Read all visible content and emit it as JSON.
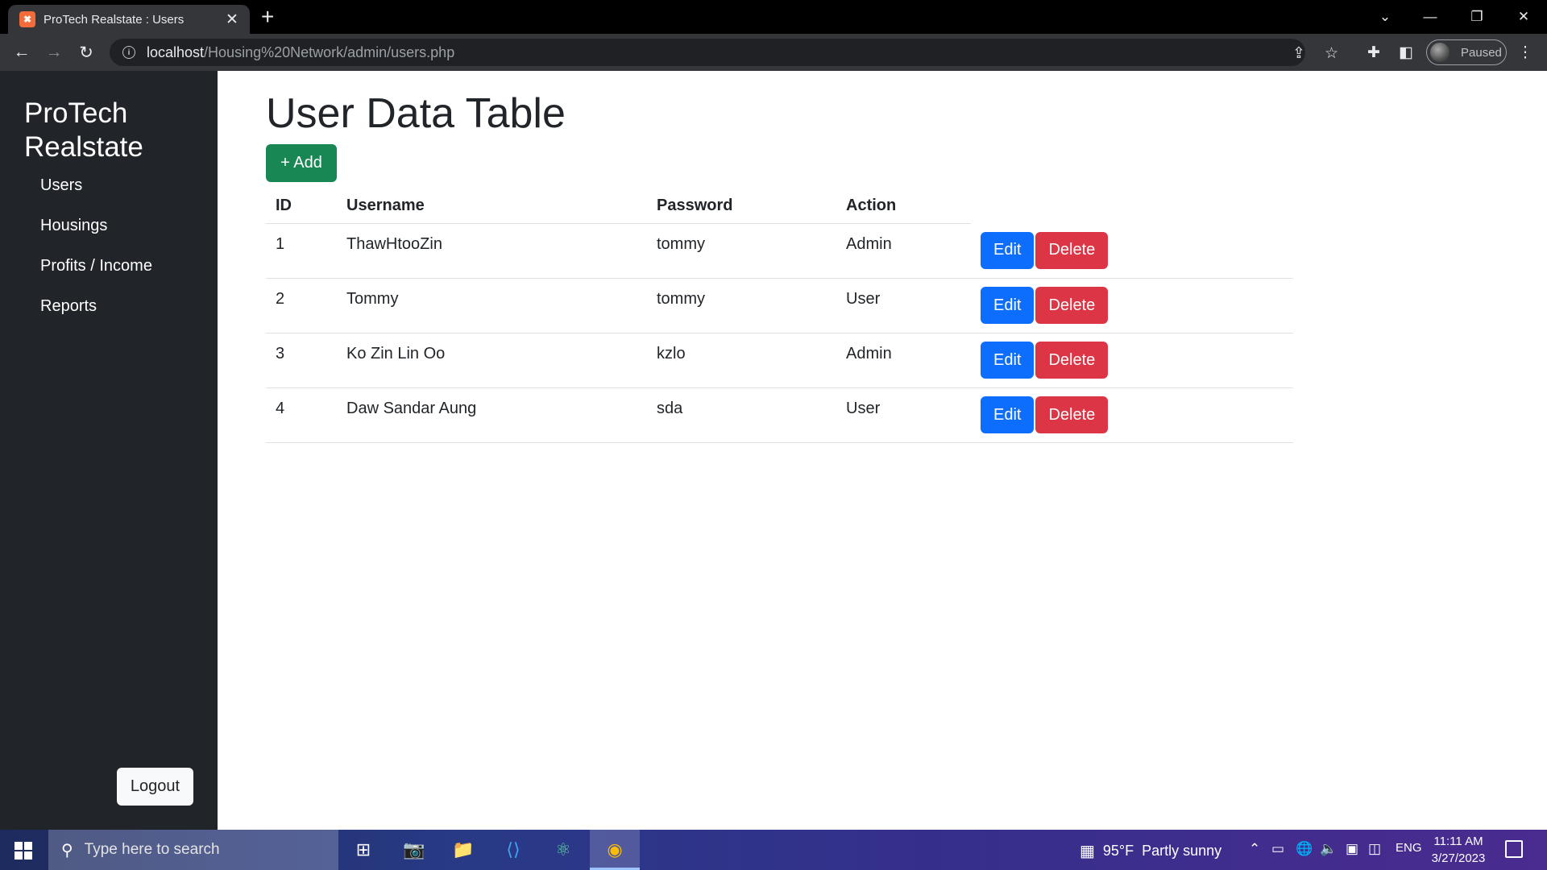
{
  "browser": {
    "tab_title": "ProTech Realstate : Users",
    "tab_favicon": "xampp-icon",
    "url_host": "localhost",
    "url_path": "/Housing%20Network/admin/users.php",
    "profile_status": "Paused"
  },
  "sidebar": {
    "brand": "ProTech Realstate",
    "items": [
      {
        "label": "Users"
      },
      {
        "label": "Housings"
      },
      {
        "label": "Profits / Income"
      },
      {
        "label": "Reports"
      }
    ],
    "logout_label": "Logout"
  },
  "main": {
    "title": "User Data Table",
    "add_label": "+ Add",
    "columns": [
      "ID",
      "Username",
      "Password",
      "Action"
    ],
    "rows": [
      {
        "id": "1",
        "username": "ThawHtooZin",
        "password": "tommy",
        "role": "Admin"
      },
      {
        "id": "2",
        "username": "Tommy",
        "password": "tommy",
        "role": "User"
      },
      {
        "id": "3",
        "username": "Ko Zin Lin Oo",
        "password": "kzlo",
        "role": "Admin"
      },
      {
        "id": "4",
        "username": "Daw Sandar Aung",
        "password": "sda",
        "role": "User"
      }
    ],
    "edit_label": "Edit",
    "delete_label": "Delete"
  },
  "colors": {
    "sidebar_bg": "#212529",
    "add_button": "#198754",
    "edit_button": "#0d6efd",
    "delete_button": "#dc3545"
  },
  "taskbar": {
    "search_placeholder": "Type here to search",
    "weather_temp": "95°F",
    "weather_text": "Partly sunny",
    "language": "ENG",
    "time": "11:11 AM",
    "date": "3/27/2023"
  }
}
